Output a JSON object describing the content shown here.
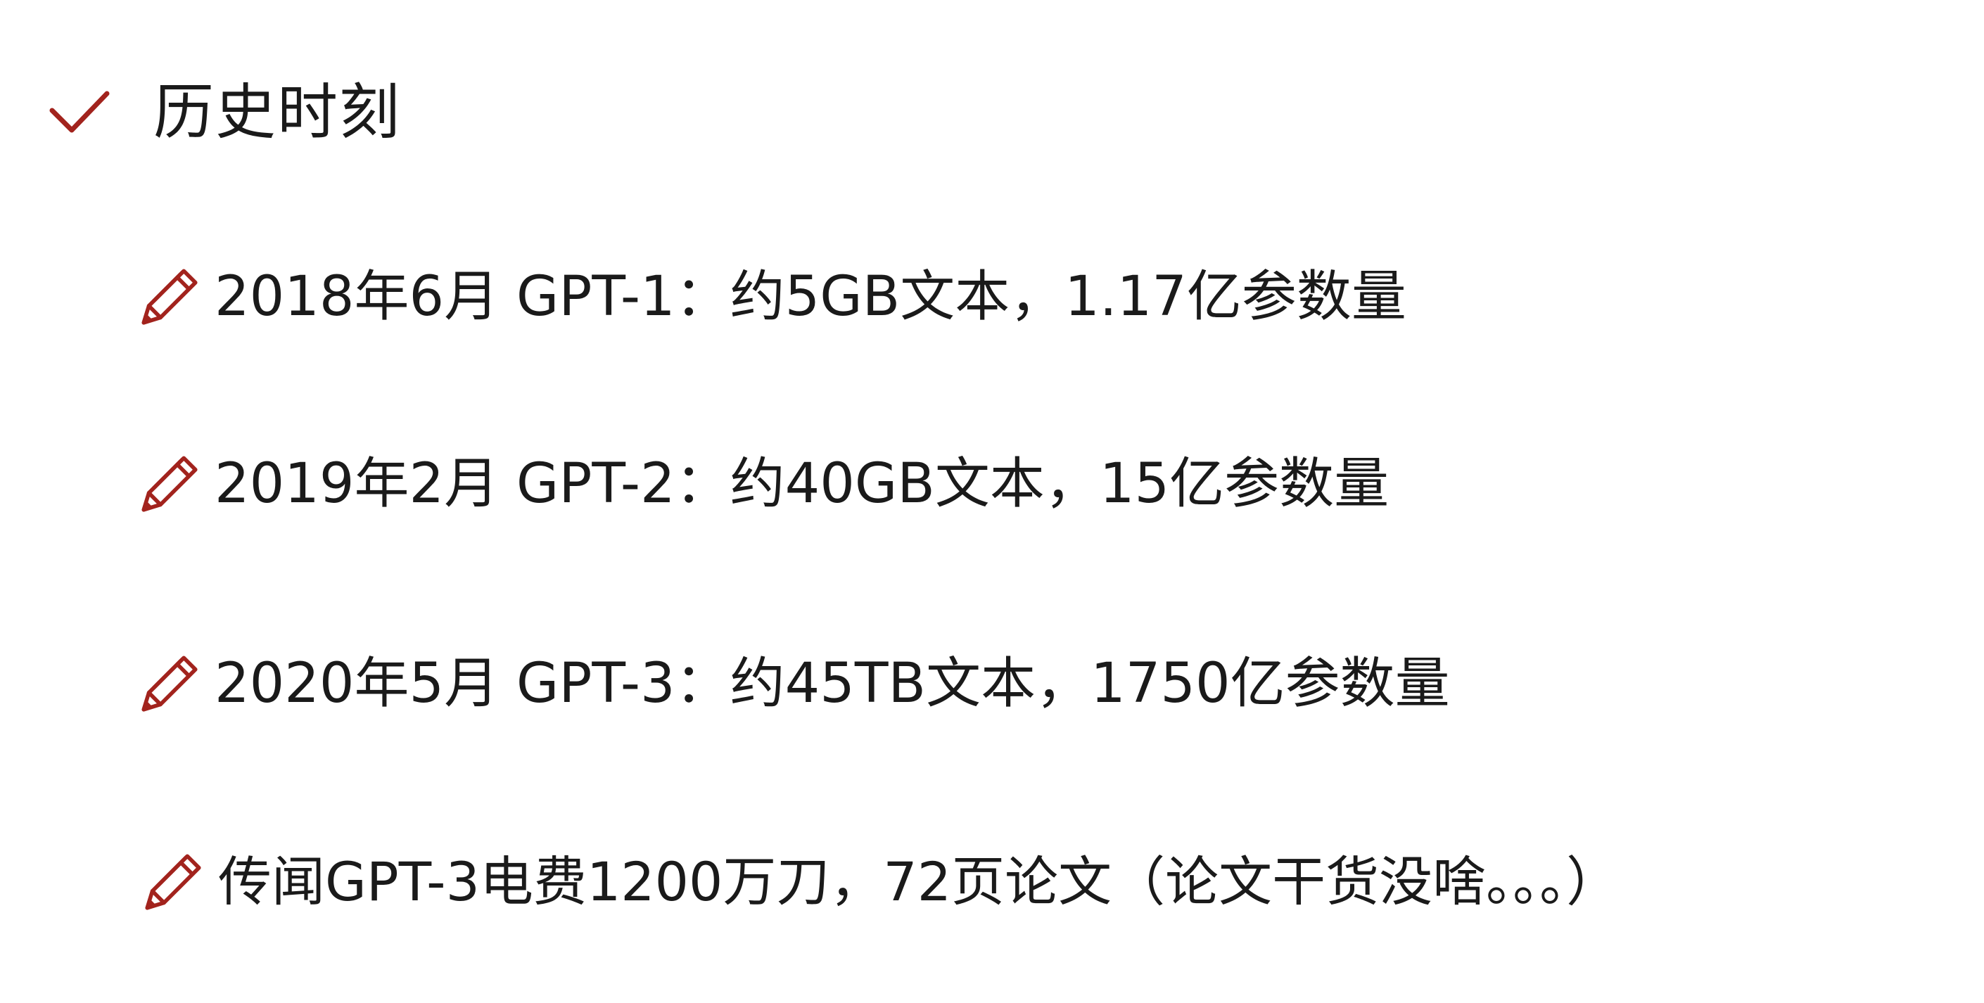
{
  "heading": {
    "icon": "check-icon",
    "text": "历史时刻"
  },
  "bullets": [
    {
      "icon": "pencil-icon",
      "text": "2018年6月 GPT-1：约5GB文本，1.17亿参数量"
    },
    {
      "icon": "pencil-icon",
      "text": "2019年2月 GPT-2：约40GB文本，15亿参数量"
    },
    {
      "icon": "pencil-icon",
      "text": "2020年5月 GPT-3：约45TB文本，1750亿参数量"
    },
    {
      "icon": "pencil-icon",
      "text": "传闻GPT-3电费1200万刀，72页论文（论文干货没啥。。。）"
    }
  ],
  "colors": {
    "icon": "#a2231d",
    "text": "#1a1a1a",
    "background": "#ffffff"
  }
}
